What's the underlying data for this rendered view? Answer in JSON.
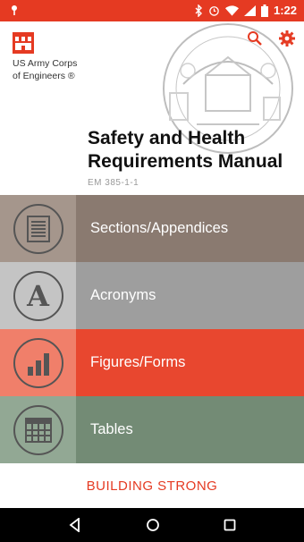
{
  "status_bar": {
    "time": "1:22",
    "accent": "#e53a22"
  },
  "header": {
    "org_line1": "US Army Corps",
    "org_line2": "of Engineers ®",
    "title_line1": "Safety and Health",
    "title_line2": "Requirements Manual",
    "subtitle": "EM 385-1-1"
  },
  "menu": [
    {
      "label": "Sections/Appendices",
      "icon": "document-icon"
    },
    {
      "label": "Acronyms",
      "icon": "letter-a-icon"
    },
    {
      "label": "Figures/Forms",
      "icon": "bar-chart-icon"
    },
    {
      "label": "Tables",
      "icon": "table-icon"
    }
  ],
  "footer": {
    "text": "BUILDING STRONG"
  }
}
